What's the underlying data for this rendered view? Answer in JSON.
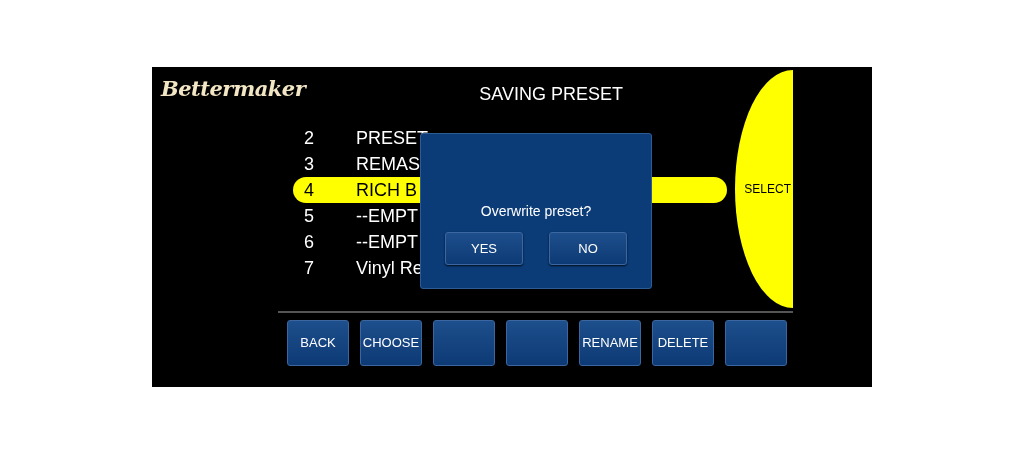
{
  "logo": "Bettermaker",
  "title": "SAVING PRESET",
  "presets": [
    {
      "number": "2",
      "name": "PRESET",
      "selected": false
    },
    {
      "number": "3",
      "name": "REMAS",
      "selected": false
    },
    {
      "number": "4",
      "name": "RICH B",
      "selected": true
    },
    {
      "number": "5",
      "name": "--EMPT",
      "selected": false
    },
    {
      "number": "6",
      "name": "--EMPT",
      "selected": false
    },
    {
      "number": "7",
      "name": "Vinyl Re",
      "selected": false
    }
  ],
  "select_button": "SELECT",
  "dialog": {
    "message": "Overwrite preset?",
    "buttons": [
      "YES",
      "NO"
    ]
  },
  "buttons": [
    {
      "kind": "labeled",
      "label": "BACK"
    },
    {
      "kind": "labeled",
      "label": "CHOOSE"
    },
    {
      "kind": "blank"
    },
    {
      "kind": "blank"
    },
    {
      "kind": "labeled",
      "label": "RENAME"
    },
    {
      "kind": "labeled",
      "label": "DELETE"
    },
    {
      "kind": "blank"
    }
  ]
}
